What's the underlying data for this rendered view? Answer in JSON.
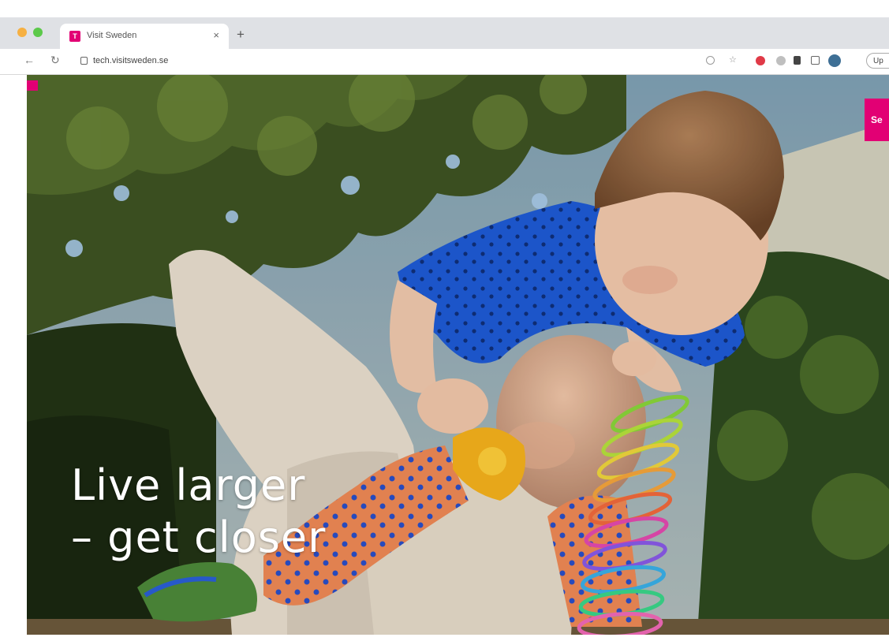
{
  "browser": {
    "tab": {
      "title": "Visit Sweden",
      "favicon_letter": "T"
    },
    "url": "tech.visitsweden.se",
    "profile_label": "Up"
  },
  "page": {
    "headline": [
      "Live larger",
      "– get closer"
    ],
    "cta_label": "Se"
  },
  "colors": {
    "brand_magenta": "#e20074",
    "tabstrip": "#dfe1e5",
    "headline": "#ffffff"
  },
  "icons": [
    "close-icon",
    "plus-icon",
    "back-arrow-icon",
    "reload-icon",
    "lock-icon",
    "share-icon",
    "star-icon",
    "extension-icon",
    "puzzle-icon",
    "sidebar-icon",
    "avatar-icon"
  ]
}
